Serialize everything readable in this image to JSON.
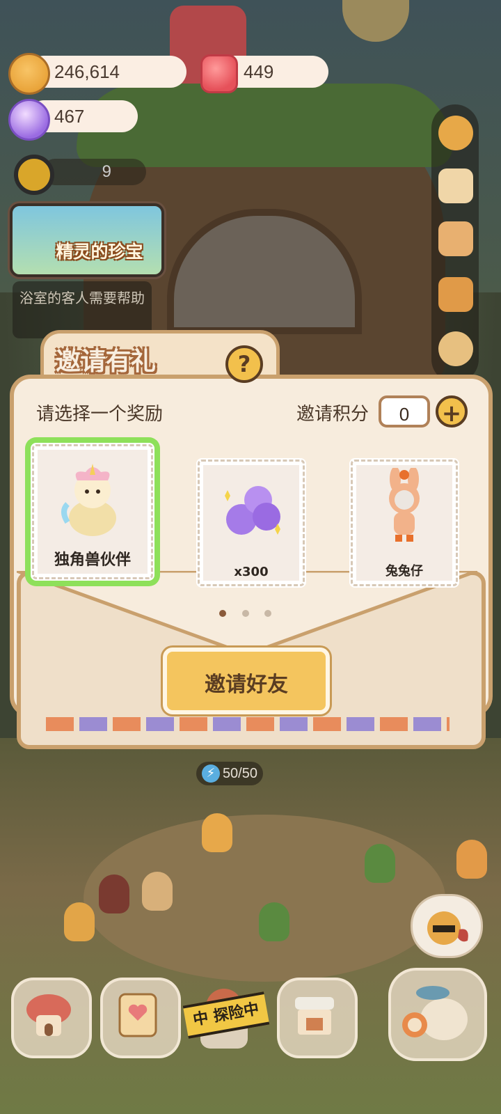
{
  "hud": {
    "cookies": "246,614",
    "gems": "449",
    "candies": "467",
    "level_counter": "9"
  },
  "event_banner": {
    "label": "精灵的珍宝"
  },
  "task_note": {
    "text": "浴室的客人需要帮助"
  },
  "dialog": {
    "title": "邀请有礼",
    "help_symbol": "?",
    "subtitle": "请选择一个奖励",
    "points_label": "邀请积分",
    "points_value": "0",
    "plus_symbol": "+",
    "rewards": [
      {
        "label": "独角兽伙伴",
        "icon": "unicorn-plush-icon",
        "selected": true
      },
      {
        "label": "x300",
        "icon": "candy-pile-icon",
        "selected": false
      },
      {
        "label": "兔兔仔",
        "icon": "bunny-costume-icon",
        "selected": false
      }
    ],
    "page_index": 1,
    "page_count": 3,
    "invite_button": "邀请好友"
  },
  "energy": {
    "value": "50/50"
  },
  "dock": {
    "explore_label": "中 探险中"
  },
  "colors": {
    "selected_outline": "#8ee05a",
    "button_yellow": "#f4c55e",
    "dialog_border": "#c9a06d"
  }
}
